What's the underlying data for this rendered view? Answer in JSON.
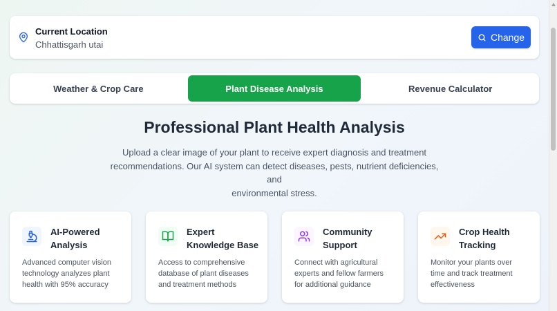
{
  "location": {
    "title": "Current Location",
    "value": "Chhattisgarh utai",
    "pin_icon": "map-pin-icon",
    "change_label": "Change",
    "change_icon": "search-icon"
  },
  "tabs": [
    {
      "label": "Weather & Crop Care",
      "active": false
    },
    {
      "label": "Plant Disease Analysis",
      "active": true
    },
    {
      "label": "Revenue Calculator",
      "active": false
    }
  ],
  "hero": {
    "title": "Professional Plant Health Analysis",
    "line1": "Upload a clear image of your plant to receive expert diagnosis and treatment",
    "line2": "recommendations. Our AI system can detect diseases, pests, nutrient deficiencies, and",
    "line3": "environmental stress."
  },
  "features": [
    {
      "icon": "microscope-icon",
      "title_line1": "AI-Powered",
      "title_line2": "Analysis",
      "desc_line1": "Advanced computer vision",
      "desc_line2": "technology analyzes plant",
      "desc_line3": "health with 95% accuracy",
      "color": "#2563eb"
    },
    {
      "icon": "book-icon",
      "title_line1": "Expert",
      "title_line2": "Knowledge Base",
      "desc_line1": "Access to comprehensive",
      "desc_line2": "database of plant diseases",
      "desc_line3": "and treatment methods",
      "color": "#16a34a"
    },
    {
      "icon": "users-icon",
      "title_line1": "Community",
      "title_line2": "Support",
      "desc_line1": "Connect with agricultural",
      "desc_line2": "experts and fellow farmers",
      "desc_line3": "for additional guidance",
      "color": "#9333ea"
    },
    {
      "icon": "trending-up-icon",
      "title_line1": "Crop Health",
      "title_line2": "Tracking",
      "desc_line1": "Monitor your plants over",
      "desc_line2": "time and track treatment",
      "desc_line3": "effectiveness",
      "color": "#ea580c"
    }
  ],
  "colors": {
    "primary_blue": "#2563eb",
    "active_tab_green": "#16a34a"
  }
}
